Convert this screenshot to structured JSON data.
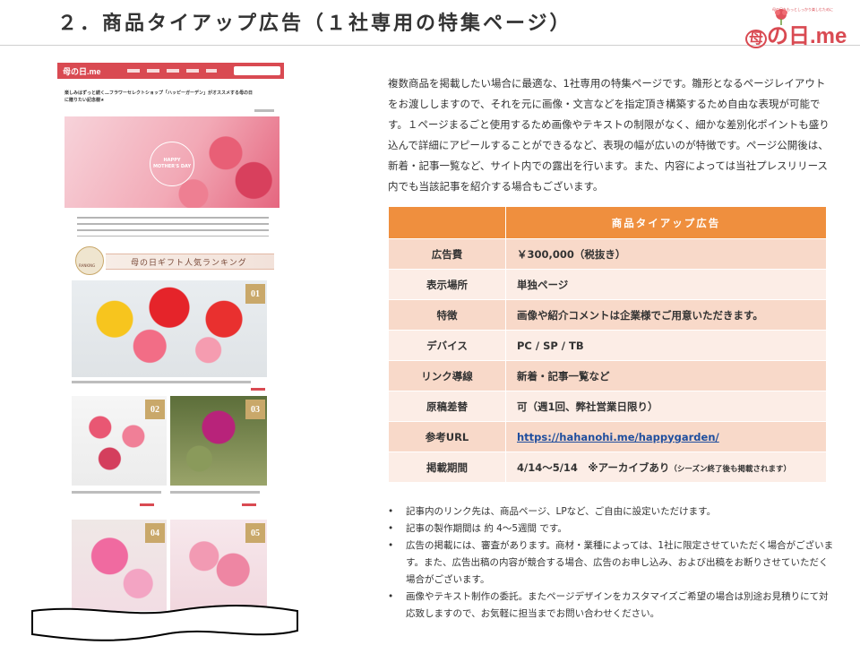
{
  "header": {
    "title": "２．商品タイアップ広告（１社専用の特集ページ）",
    "brand_logo": "の日.me",
    "brand_logo_prefix": "母",
    "brand_tagline": "母の日をもっとしっかり楽しむために"
  },
  "mock": {
    "nav_logo": "母の日.me",
    "article_title": "楽しみはずっと続く…フラワーセレクトショップ「ハッピーガーデン」がオススメする母の日に贈りたい記念樹★",
    "hero_badge": "HAPPY MOTHER'S DAY",
    "ranking_title": "母の日ギフト人気ランキング",
    "ranking_badge": "RANKING",
    "ranks": [
      "01",
      "02",
      "03",
      "04",
      "05"
    ]
  },
  "description": "複数商品を掲載したい場合に最適な、1社専用の特集ページです。雛形となるページレイアウトをお渡ししますので、それを元に画像・文言などを指定頂き構築するため自由な表現が可能です。１ページまるごと使用するため画像やテキストの制限がなく、細かな差別化ポイントも盛り込んで詳細にアピールすることができるなど、表現の幅が広いのが特徴です。ページ公開後は、新着・記事一覧など、サイト内での露出を行います。また、内容によっては当社プレスリリース内でも当該記事を紹介する場合もございます。",
  "table": {
    "header": "商品タイアップ広告",
    "rows": [
      {
        "label": "広告費",
        "value": "￥300,000（税抜き）"
      },
      {
        "label": "表示場所",
        "value": "単独ページ"
      },
      {
        "label": "特徴",
        "value": "画像や紹介コメントは企業様でご用意いただきます。"
      },
      {
        "label": "デバイス",
        "value": "PC / SP / TB"
      },
      {
        "label": "リンク導線",
        "value": "新着・記事一覧など"
      },
      {
        "label": "原稿差替",
        "value": "可（週1回、弊社営業日限り）"
      },
      {
        "label": "参考URL",
        "value": "https://hahanohi.me/happygarden/"
      },
      {
        "label": "掲載期間",
        "value": "4/14～5/14　※アーカイブあり",
        "note": "（シーズン終了後も掲載されます）"
      }
    ]
  },
  "notes": [
    "記事内のリンク先は、商品ページ、LPなど、ご自由に設定いただけます。",
    "記事の製作期間は 約 4～5週間 です。",
    "広告の掲載には、審査があります。商材・業種によっては、1社に限定させていただく場合がございます。また、広告出稿の内容が競合する場合、広告のお申し込み、および出稿をお断りさせていただく場合がございます。",
    "画像やテキスト制作の委託。またページデザインをカスタマイズご希望の場合は別途お見積りにて対応致しますので、お気軽に担当までお問い合わせください。"
  ],
  "colors": {
    "accent": "#ef8f3e",
    "brand": "#d94a52",
    "row_odd": "#f8d9c9",
    "row_even": "#fcede6",
    "link": "#1f4e9e"
  }
}
